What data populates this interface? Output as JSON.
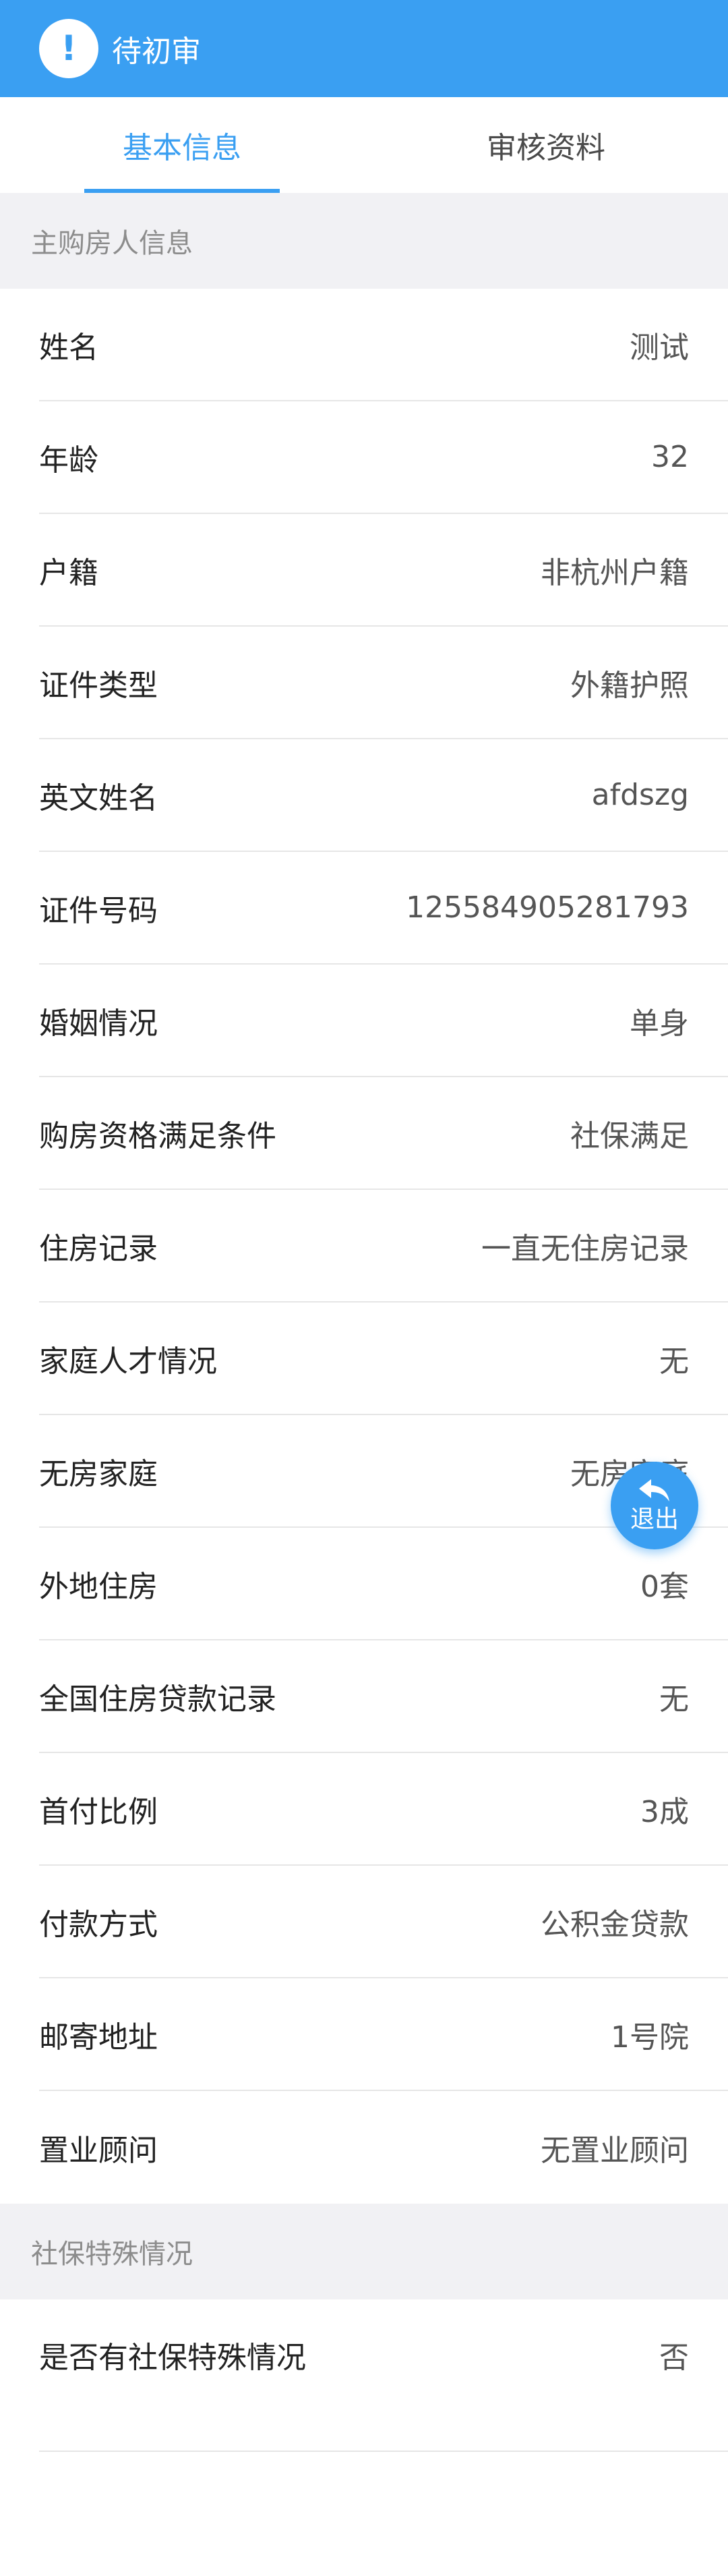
{
  "header": {
    "status_icon": "!",
    "status_title": "待初审"
  },
  "tabs": [
    {
      "label": "基本信息",
      "active": true
    },
    {
      "label": "审核资料",
      "active": false
    }
  ],
  "main_buyer": {
    "section_title": "主购房人信息",
    "rows": [
      {
        "label": "姓名",
        "value": "测试"
      },
      {
        "label": "年龄",
        "value": "32"
      },
      {
        "label": "户籍",
        "value": "非杭州户籍"
      },
      {
        "label": "证件类型",
        "value": "外籍护照"
      },
      {
        "label": "英文姓名",
        "value": "afdszg"
      },
      {
        "label": "证件号码",
        "value": "125584905281793"
      },
      {
        "label": "婚姻情况",
        "value": "单身"
      },
      {
        "label": "购房资格满足条件",
        "value": "社保满足"
      },
      {
        "label": "住房记录",
        "value": "一直无住房记录"
      },
      {
        "label": "家庭人才情况",
        "value": "无"
      },
      {
        "label": "无房家庭",
        "value": "无房家庭"
      },
      {
        "label": "外地住房",
        "value": "0套"
      },
      {
        "label": "全国住房贷款记录",
        "value": "无"
      },
      {
        "label": "首付比例",
        "value": "3成"
      },
      {
        "label": "付款方式",
        "value": "公积金贷款"
      },
      {
        "label": "邮寄地址",
        "value": "1号院"
      },
      {
        "label": "置业顾问",
        "value": "无置业顾问"
      }
    ]
  },
  "social_security": {
    "section_title": "社保特殊情况",
    "row": {
      "label": "是否有社保特殊情况",
      "value": "否"
    }
  },
  "exit_button": {
    "label": "退出",
    "icon": "reply-arrow-icon"
  },
  "colors": {
    "accent": "#3a9ff2",
    "section_bg": "#f1f1f4"
  }
}
